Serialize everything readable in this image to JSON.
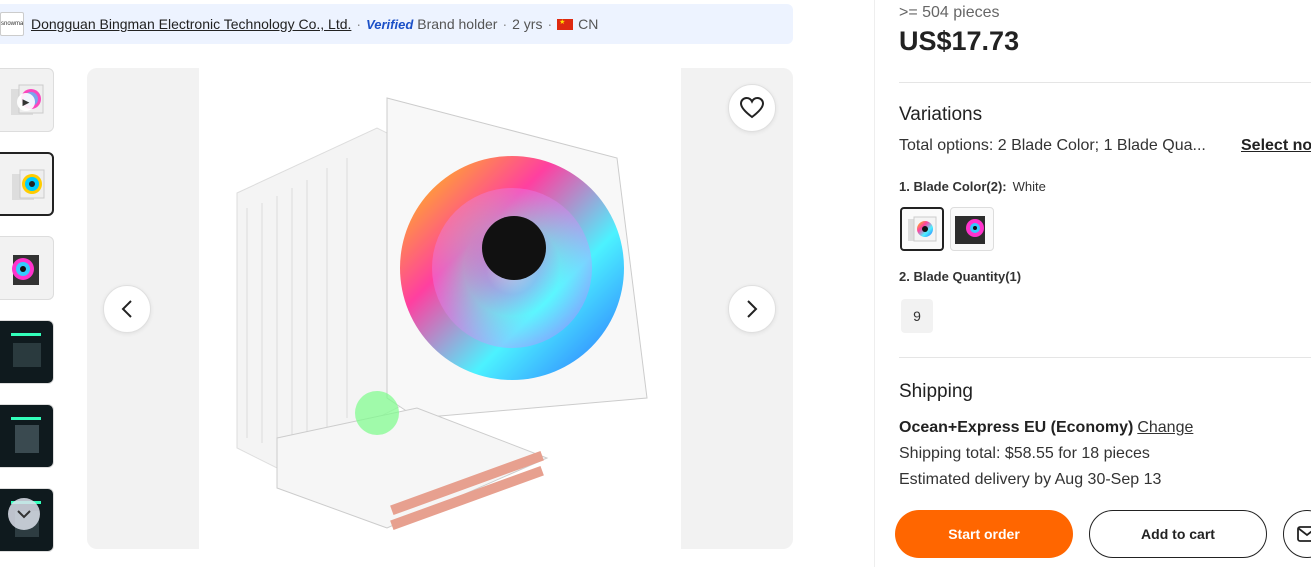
{
  "supplier": {
    "logo_text": "snowman",
    "name": "Dongguan Bingman Electronic Technology Co., Ltd.",
    "verified": "Verified",
    "role": "Brand holder",
    "years": "2 yrs",
    "country": "CN"
  },
  "gallery": {
    "icons": [
      "play-icon",
      "chevron-down-icon",
      "chevron-left-icon",
      "chevron-right-icon",
      "heart-icon"
    ]
  },
  "pricing": {
    "min_qty": ">= 504 pieces",
    "price": "US$17.73"
  },
  "variations": {
    "title": "Variations",
    "total_options": "Total options: 2 Blade Color; 1 Blade Qua...",
    "select_now": "Select now",
    "blade_color_label": "1. Blade Color(2):",
    "blade_color_value": "White",
    "blade_quantity_label": "2. Blade Quantity(1)",
    "blade_quantity_option": "9"
  },
  "shipping": {
    "title": "Shipping",
    "method": "Ocean+Express EU (Economy)",
    "change": "Change",
    "total": "Shipping total: $58.55 for 18 pieces",
    "delivery": "Estimated delivery by Aug 30-Sep 13"
  },
  "actions": {
    "start_order": "Start order",
    "add_to_cart": "Add to cart",
    "message_icon": "mail-icon"
  },
  "colors": {
    "accent": "#ff6600",
    "verified": "#1a4fc7",
    "supplier_bar": "#edf3ff"
  }
}
